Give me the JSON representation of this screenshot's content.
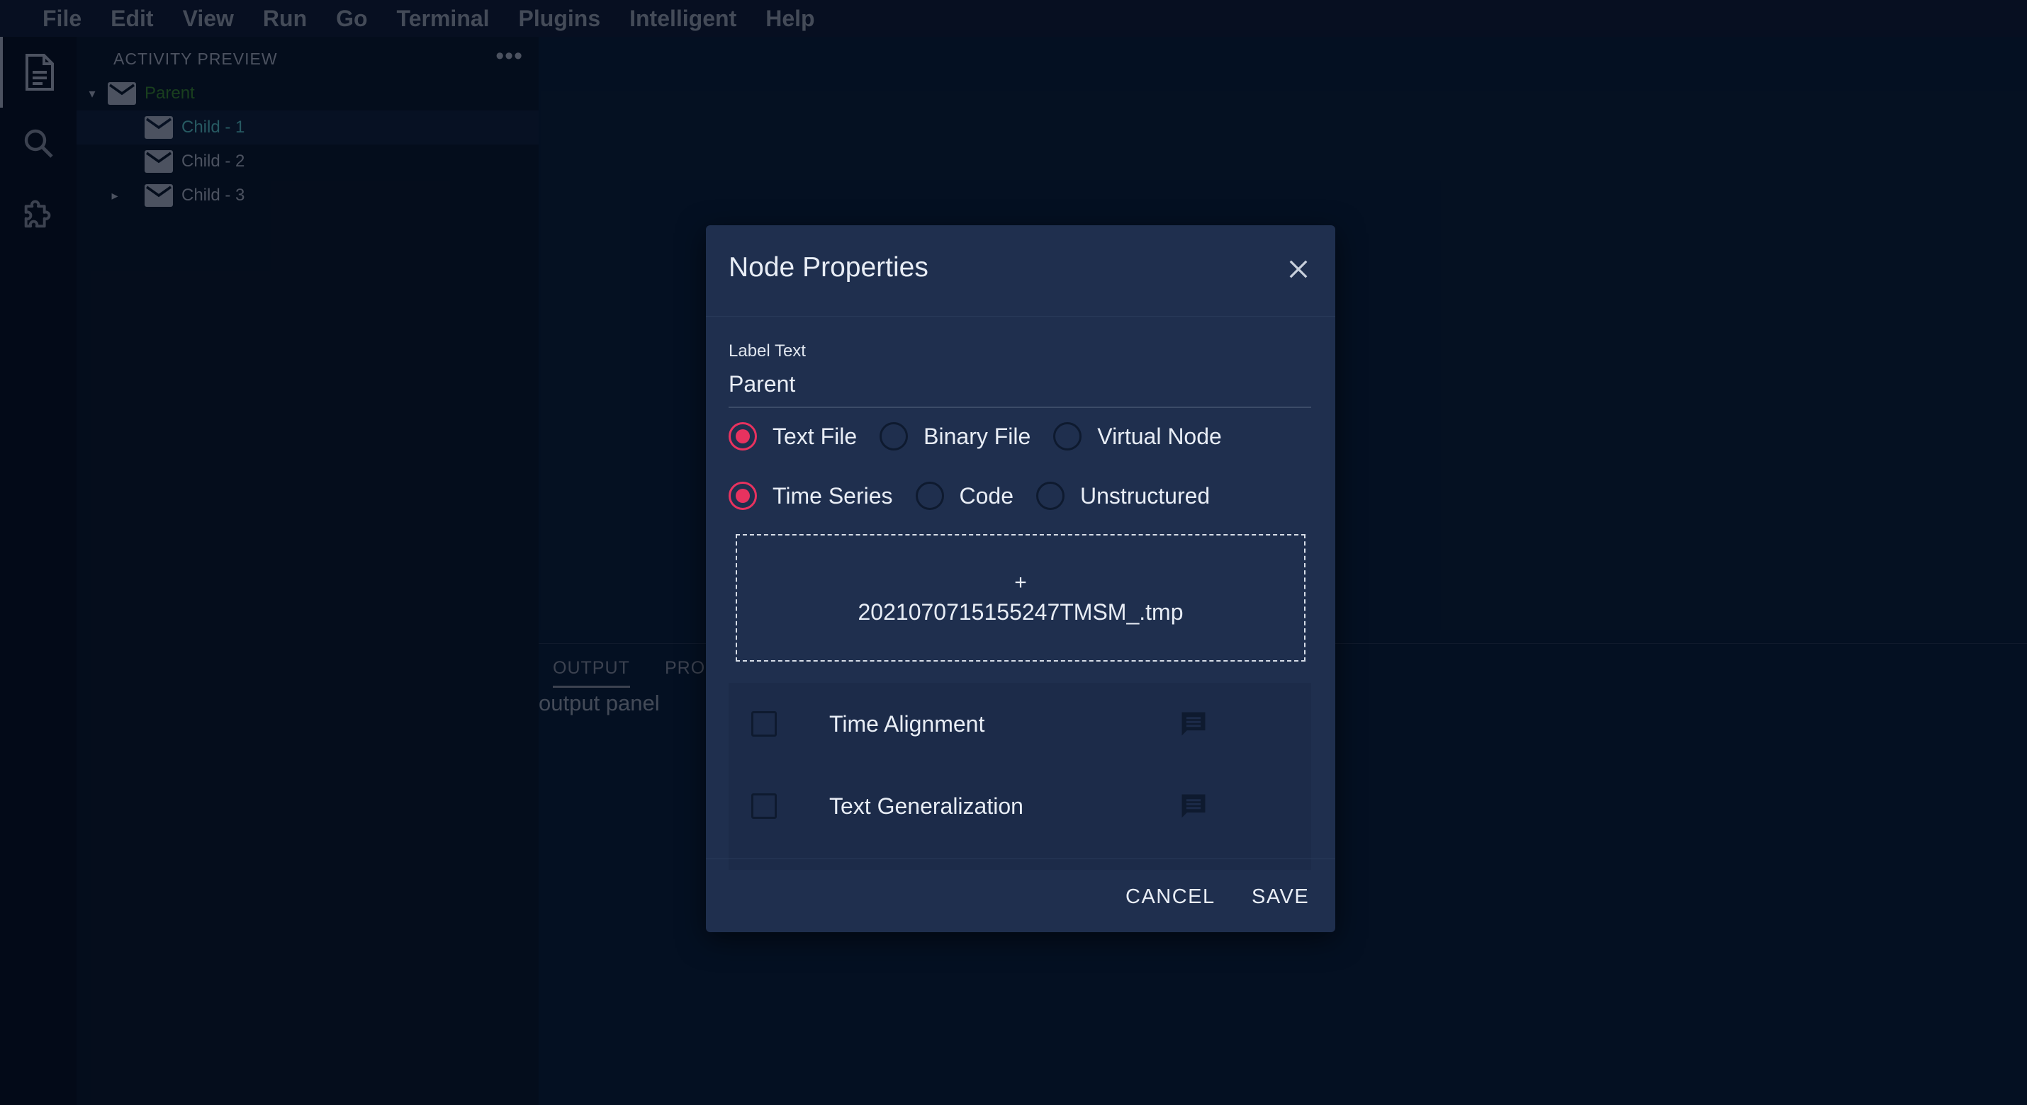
{
  "menubar": {
    "items": [
      "File",
      "Edit",
      "View",
      "Run",
      "Go",
      "Terminal",
      "Plugins",
      "Intelligent",
      "Help"
    ]
  },
  "activitybar": {
    "icons": [
      "file-icon",
      "search-icon",
      "puzzle-icon"
    ]
  },
  "sidebar": {
    "header": "ACTIVITY PREVIEW",
    "more": "•••",
    "tree": [
      {
        "label": "Parent",
        "color": "#2f6f2a",
        "expanded": true
      },
      {
        "label": "Child - 1",
        "color": "#47a0a6",
        "selected": true
      },
      {
        "label": "Child - 2",
        "color": "#8a93a3"
      },
      {
        "label": "Child - 3",
        "color": "#8a93a3",
        "collapsed": true
      }
    ]
  },
  "panel": {
    "tabs": [
      "OUTPUT",
      "PROBLEMS"
    ],
    "text": "output panel"
  },
  "dialog": {
    "title": "Node Properties",
    "field_label": "Label Text",
    "field_value": "Parent",
    "type_options": [
      {
        "label": "Text File",
        "selected": true
      },
      {
        "label": "Binary File",
        "selected": false
      },
      {
        "label": "Virtual Node",
        "selected": false
      }
    ],
    "format_options": [
      {
        "label": "Time Series",
        "selected": true
      },
      {
        "label": "Code",
        "selected": false
      },
      {
        "label": "Unstructured",
        "selected": false
      }
    ],
    "dropzone": {
      "plus": "+",
      "filename": "2021070715155247TMSM_.tmp"
    },
    "checks": [
      {
        "label": "Time Alignment",
        "checked": false
      },
      {
        "label": "Text Generalization",
        "checked": false
      }
    ],
    "cancel": "CANCEL",
    "save": "SAVE"
  },
  "colors": {
    "accent": "#e8325f",
    "dialog_bg": "#1f2f4e",
    "app_bg": "#0c1a33"
  }
}
